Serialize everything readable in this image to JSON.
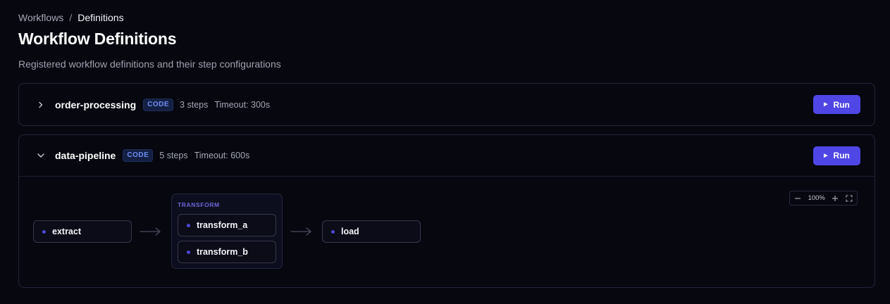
{
  "breadcrumb": {
    "parent": "Workflows",
    "separator": "/",
    "current": "Definitions"
  },
  "page": {
    "title": "Workflow Definitions",
    "subtitle": "Registered workflow definitions and their step configurations"
  },
  "workflows": [
    {
      "name": "order-processing",
      "badge": "CODE",
      "steps": "3 steps",
      "timeout": "Timeout: 300s",
      "run_label": "Run",
      "expanded": false
    },
    {
      "name": "data-pipeline",
      "badge": "CODE",
      "steps": "5 steps",
      "timeout": "Timeout: 600s",
      "run_label": "Run",
      "expanded": true
    }
  ],
  "graph": {
    "nodes": {
      "extract": "extract",
      "transform_a": "transform_a",
      "transform_b": "transform_b",
      "load": "load"
    },
    "group_label": "TRANSFORM",
    "zoom": "100%"
  },
  "colors": {
    "accent": "#4f46e5",
    "background": "#06070f",
    "badge_text": "#6f8ef7"
  }
}
